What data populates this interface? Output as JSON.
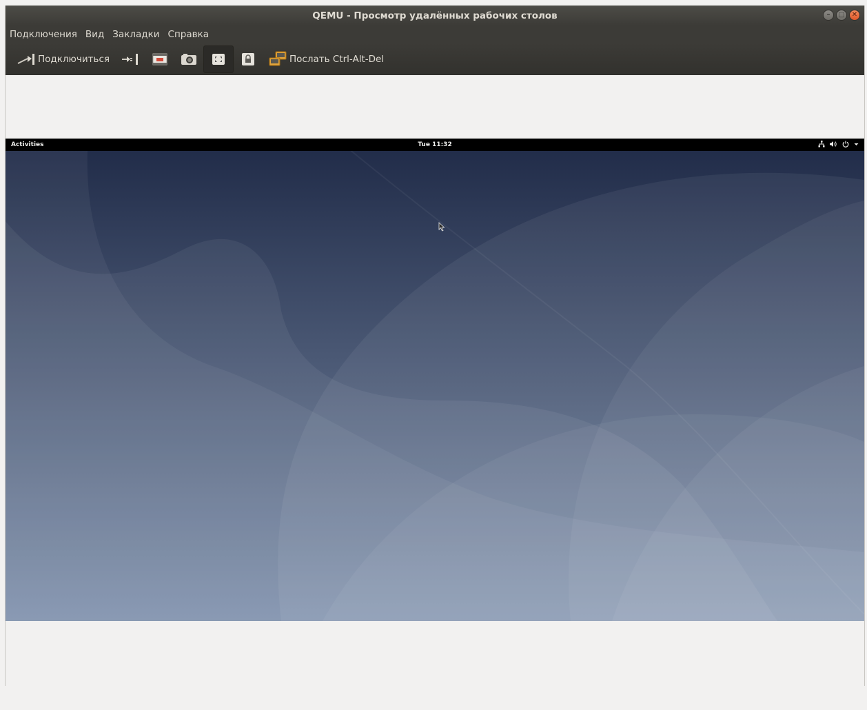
{
  "window": {
    "title": "QEMU - Просмотр удалённых рабочих столов",
    "controls": [
      "minimize",
      "maximize",
      "close"
    ]
  },
  "menubar": {
    "items": [
      {
        "label": "Подключения"
      },
      {
        "label": "Вид"
      },
      {
        "label": "Закладки"
      },
      {
        "label": "Справка"
      }
    ]
  },
  "toolbar": {
    "connect_label": "Подключиться",
    "send_cad_label": "Послать Ctrl-Alt-Del",
    "icons": [
      "connect-icon",
      "disconnect-icon",
      "fullscreen-icon",
      "screenshot-icon",
      "scaling-icon",
      "keyboard-lock-icon",
      "send-keys-icon"
    ]
  },
  "vm": {
    "topbar": {
      "activities": "Activities",
      "clock": "Tue 11:32",
      "tray_icons": [
        "network-icon",
        "volume-icon",
        "power-icon",
        "chevron-down-icon"
      ]
    },
    "colors": {
      "wallpaper_top": "#1f2a47",
      "wallpaper_bottom": "#7d8fab"
    }
  }
}
